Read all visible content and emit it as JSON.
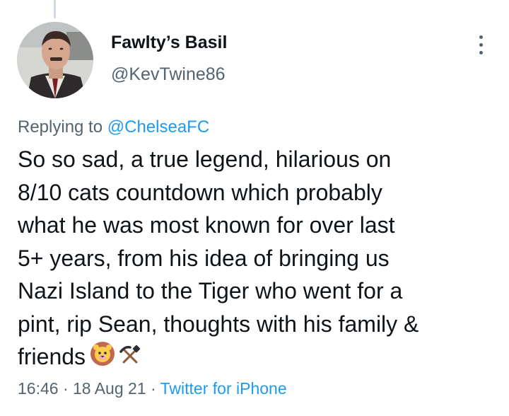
{
  "tweet": {
    "author": {
      "display_name": "Fawlty’s Basil",
      "handle": "@KevTwine86"
    },
    "reply_context": {
      "prefix": "Replying to ",
      "mention": "@ChelseaFC"
    },
    "text_lines": [
      "So so sad, a true legend, hilarious on",
      "8/10 cats countdown which probably",
      "what he was most known for over last",
      "5+ years, from his idea of bringing us",
      "Nazi Island to the Tiger who went for a",
      "pint, rip Sean, thoughts with his family &",
      "friends"
    ],
    "emojis": [
      "lion-face-icon",
      "hammer-and-pick-icon"
    ],
    "meta": {
      "time": "16:46",
      "separator": " · ",
      "date": "18 Aug 21",
      "source": "Twitter for iPhone"
    }
  },
  "colors": {
    "text": "#0f1419",
    "secondary": "#536471",
    "link": "#1d9bf0"
  }
}
